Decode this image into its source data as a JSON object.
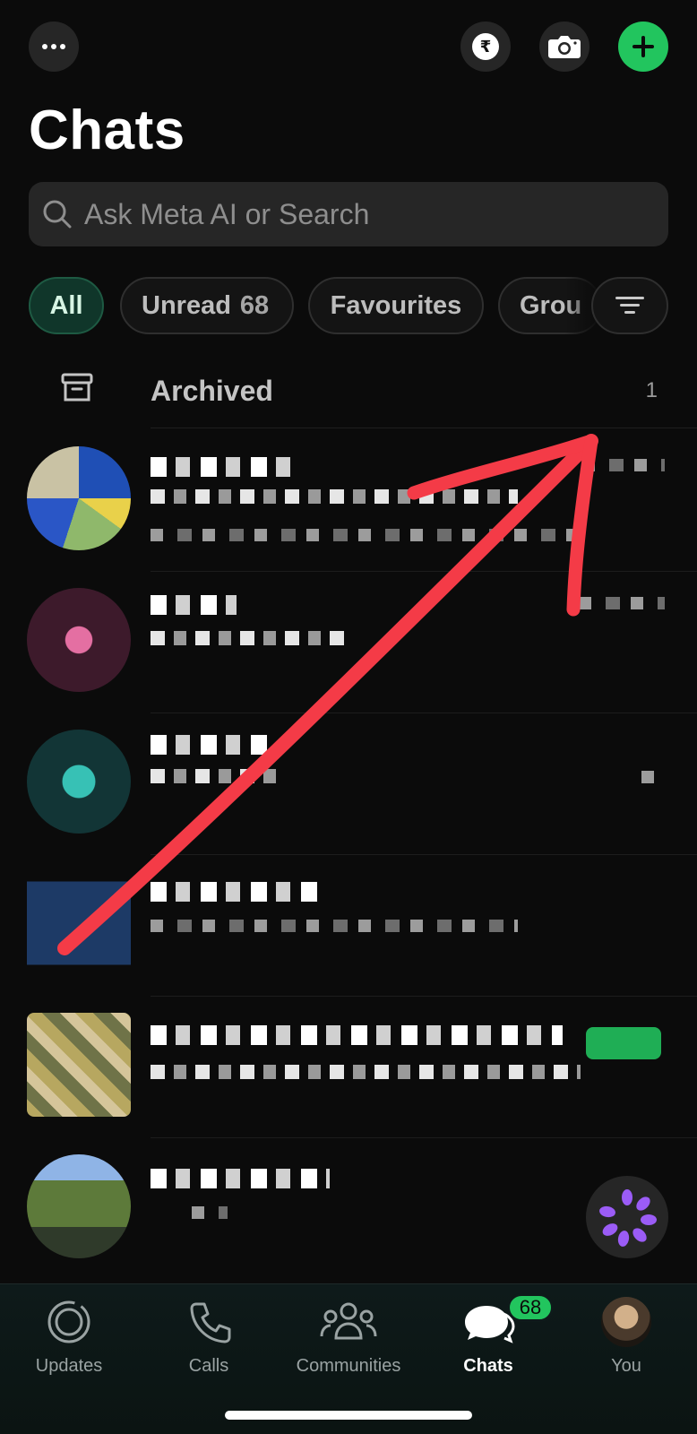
{
  "header": {
    "title": "Chats",
    "more_icon": "more-horizontal-icon",
    "payments_icon": "rupee-icon",
    "camera_icon": "camera-icon",
    "new_chat_icon": "plus-icon"
  },
  "search": {
    "placeholder": "Ask Meta AI or Search"
  },
  "filters": [
    {
      "label": "All",
      "active": true
    },
    {
      "label": "Unread",
      "count": "68"
    },
    {
      "label": "Favourites"
    },
    {
      "label": "Grou"
    }
  ],
  "archived": {
    "label": "Archived",
    "count": "1"
  },
  "tabbar": {
    "items": [
      {
        "label": "Updates",
        "icon": "updates-icon"
      },
      {
        "label": "Calls",
        "icon": "phone-icon"
      },
      {
        "label": "Communities",
        "icon": "communities-icon"
      },
      {
        "label": "Chats",
        "icon": "chat-bubbles-icon",
        "badge": "68",
        "active": true
      },
      {
        "label": "You",
        "icon": "profile-avatar"
      }
    ]
  },
  "colors": {
    "background": "#0b0b0b",
    "accent_green": "#22c55e",
    "annotation_red": "#f43b47"
  }
}
